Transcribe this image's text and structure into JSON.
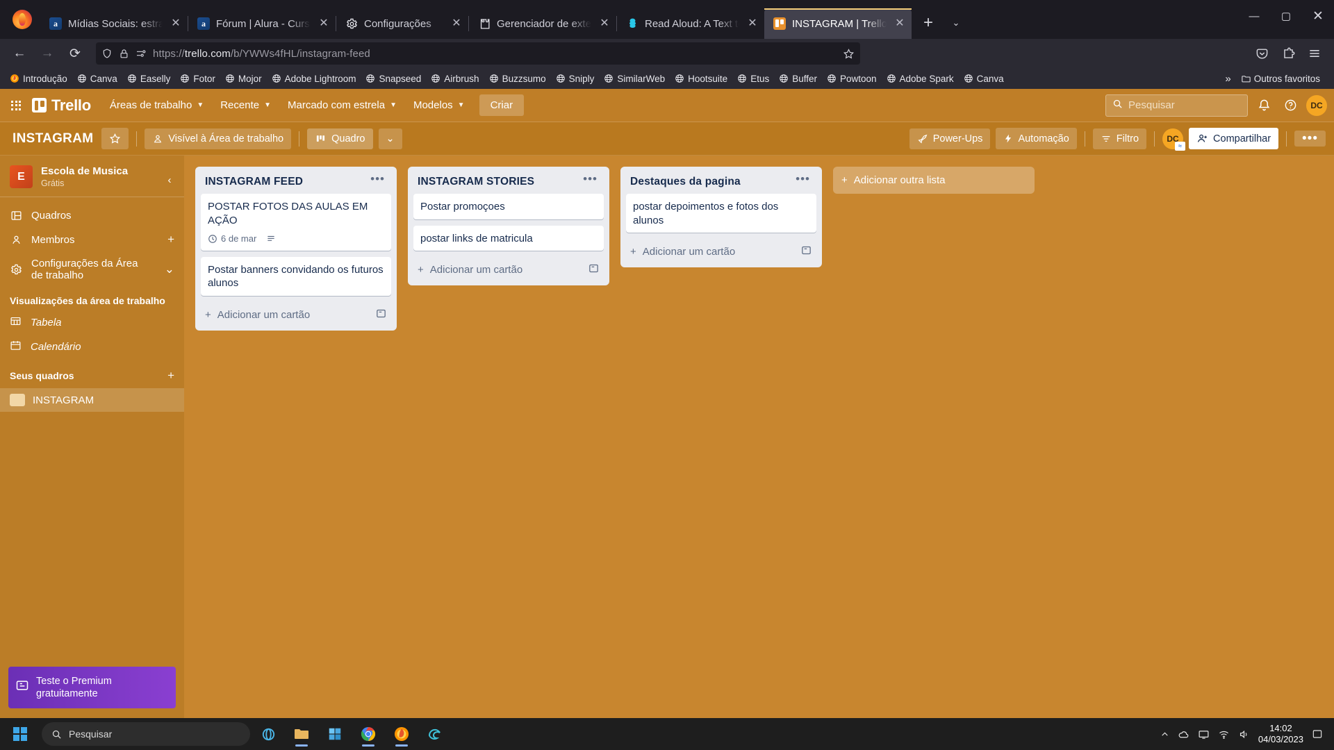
{
  "browser": {
    "tabs": [
      {
        "title": "Mídias Sociais: estratégias p",
        "favicon": "alura-icon",
        "active": false
      },
      {
        "title": "Fórum | Alura - Cursos onlin",
        "favicon": "alura-icon",
        "active": false
      },
      {
        "title": "Configurações",
        "favicon": "gear-icon",
        "active": false
      },
      {
        "title": "Gerenciador de extensões",
        "favicon": "extension-icon",
        "active": false
      },
      {
        "title": "Read Aloud: A Text to Speec",
        "favicon": "readaloud-icon",
        "active": false
      },
      {
        "title": "INSTAGRAM | Trello",
        "favicon": "trello-icon",
        "active": true
      }
    ],
    "url_display": {
      "scheme": "https://",
      "domain": "trello.com",
      "path": "/b/YWWs4fHL/instagram-feed"
    },
    "url_full": "https://trello.com/b/YWWs4fHL/instagram-feed",
    "bookmarks": [
      {
        "label": "Introdução",
        "icon": "firefox-icon"
      },
      {
        "label": "Canva",
        "icon": "globe-icon"
      },
      {
        "label": "Easelly",
        "icon": "globe-icon"
      },
      {
        "label": "Fotor",
        "icon": "globe-icon"
      },
      {
        "label": "Mojor",
        "icon": "globe-icon"
      },
      {
        "label": "Adobe Lightroom",
        "icon": "globe-icon"
      },
      {
        "label": "Snapseed",
        "icon": "globe-icon"
      },
      {
        "label": "Airbrush",
        "icon": "globe-icon"
      },
      {
        "label": "Buzzsumo",
        "icon": "globe-icon"
      },
      {
        "label": "Sniply",
        "icon": "globe-icon"
      },
      {
        "label": "SimilarWeb",
        "icon": "globe-icon"
      },
      {
        "label": "Hootsuite",
        "icon": "globe-icon"
      },
      {
        "label": "Etus",
        "icon": "globe-icon"
      },
      {
        "label": "Buffer",
        "icon": "globe-icon"
      },
      {
        "label": "Powtoon",
        "icon": "globe-icon"
      },
      {
        "label": "Adobe Spark",
        "icon": "globe-icon"
      },
      {
        "label": "Canva",
        "icon": "globe-icon"
      }
    ],
    "other_bookmarks": "Outros favoritos"
  },
  "trello_nav": {
    "logo_text": "Trello",
    "items": [
      {
        "label": "Áreas de trabalho",
        "caret": "⌄"
      },
      {
        "label": "Recente",
        "caret": "⌄"
      },
      {
        "label": "Marcado com estrela",
        "caret": "⌄"
      },
      {
        "label": "Modelos",
        "caret": "⌄"
      }
    ],
    "create_label": "Criar",
    "search_placeholder": "Pesquisar",
    "avatar_initials": "DC"
  },
  "board_bar": {
    "title": "INSTAGRAM",
    "visibility_label": "Visível à Área de trabalho",
    "view_label": "Quadro",
    "powerups_label": "Power-Ups",
    "automation_label": "Automação",
    "filter_label": "Filtro",
    "share_label": "Compartilhar",
    "member_initials": "DC"
  },
  "sidebar": {
    "workspace_name": "Escola de Musica",
    "workspace_plan": "Grátis",
    "workspace_initial": "E",
    "items": [
      {
        "label": "Quadros",
        "icon": "board-icon",
        "trailing": ""
      },
      {
        "label": "Membros",
        "icon": "member-icon",
        "trailing": "+"
      },
      {
        "label": "Configurações da Área de trabalho",
        "icon": "gear-icon",
        "trailing": "⌄"
      }
    ],
    "views_heading": "Visualizações da área de trabalho",
    "views": [
      {
        "label": "Tabela",
        "icon": "table-icon"
      },
      {
        "label": "Calendário",
        "icon": "calendar-icon"
      }
    ],
    "boards_heading": "Seus quadros",
    "boards_add": "+",
    "boards": [
      {
        "label": "INSTAGRAM",
        "color": "#f2d7a7"
      }
    ],
    "premium_label": "Teste o Premium gratuitamente"
  },
  "board": {
    "lists": [
      {
        "title": "INSTAGRAM FEED",
        "cards": [
          {
            "text": "POSTAR FOTOS DAS AULAS EM AÇÃO",
            "due": "6 de mar",
            "has_description": true
          },
          {
            "text": "Postar banners convidando os futuros alunos",
            "due": "",
            "has_description": false
          }
        ],
        "add_card_label": "Adicionar um cartão"
      },
      {
        "title": "INSTAGRAM STORIES",
        "cards": [
          {
            "text": "Postar promoçoes",
            "due": "",
            "has_description": false
          },
          {
            "text": "postar links de matricula",
            "due": "",
            "has_description": false
          }
        ],
        "add_card_label": "Adicionar um cartão"
      },
      {
        "title": "Destaques da pagina",
        "cards": [
          {
            "text": "postar depoimentos e fotos dos alunos",
            "due": "",
            "has_description": false
          }
        ],
        "add_card_label": "Adicionar um cartão"
      }
    ],
    "add_list_label": "Adicionar outra lista"
  },
  "taskbar": {
    "search_placeholder": "Pesquisar",
    "time": "14:02",
    "date": "04/03/2023"
  },
  "colors": {
    "board_bg": "#c8862f",
    "nav_bg": "#bf7e27",
    "accent_orange": "#f5a623",
    "card_text": "#172b4d"
  }
}
